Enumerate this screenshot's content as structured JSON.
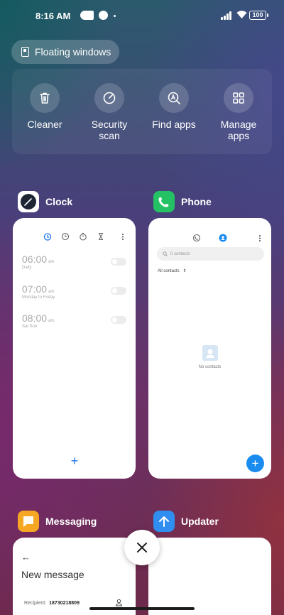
{
  "status_bar": {
    "time": "8:16 AM",
    "battery": "100"
  },
  "floating_windows": {
    "label": "Floating windows"
  },
  "tools": [
    {
      "label": "Cleaner",
      "icon": "trash-icon"
    },
    {
      "label": "Security scan",
      "icon": "speedometer-icon"
    },
    {
      "label": "Find apps",
      "icon": "search-a-icon"
    },
    {
      "label": "Manage apps",
      "icon": "grid-icon"
    }
  ],
  "apps": {
    "clock": {
      "name": "Clock",
      "alarms": [
        {
          "time": "06:00",
          "ampm": "am",
          "sub": "Daily"
        },
        {
          "time": "07:00",
          "ampm": "am",
          "sub": "Monday to Friday"
        },
        {
          "time": "08:00",
          "ampm": "am",
          "sub": "Sat Sun"
        }
      ],
      "add": "+"
    },
    "phone": {
      "name": "Phone",
      "search_placeholder": "0 contacts",
      "filter": "All contacts",
      "empty": "No contacts",
      "add": "+"
    },
    "messaging": {
      "name": "Messaging",
      "back": "←",
      "title": "New message",
      "recipient_label": "Recipient:",
      "recipient_value": "18730218809"
    },
    "updater": {
      "name": "Updater"
    }
  },
  "colors": {
    "accent": "#1a8cf0",
    "phone_green": "#25c265",
    "updater_blue": "#2f8ef0",
    "messaging_orange": "#f5a623",
    "clock_dark": "#1f2633"
  }
}
